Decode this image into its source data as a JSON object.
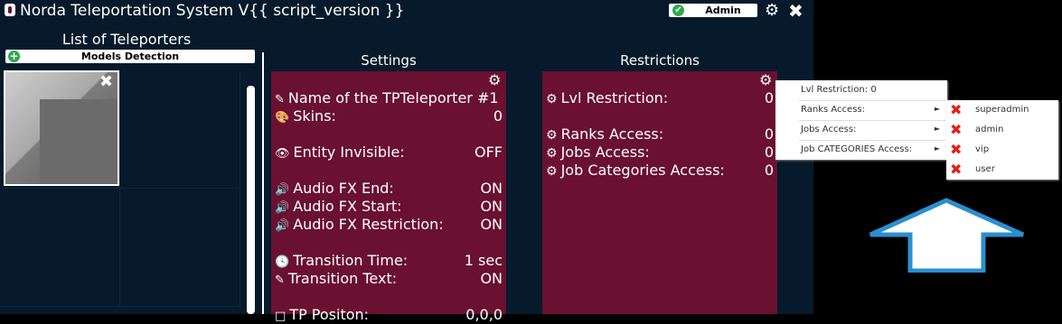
{
  "window": {
    "title": "Norda Teleportation System V{{ script_version }}",
    "role_badge": "Admin",
    "icons": [
      "app-icon",
      "check-icon",
      "gear-icon",
      "close-icon"
    ]
  },
  "left_panel": {
    "title": "List of Teleporters",
    "models_button": "Models Detection",
    "teleporter_thumb_icons": [
      "close-icon"
    ]
  },
  "settings": {
    "title": "Settings",
    "rows": [
      {
        "icon": "pencil-icon",
        "glyph": "✎",
        "label": "Name of the TPTeleporter #1",
        "value": ""
      },
      {
        "icon": "palette-icon",
        "glyph": "🎨",
        "label": "Skins:",
        "value": "0"
      },
      {
        "icon": "eye-icon",
        "glyph": "👁",
        "label": "Entity Invisible:",
        "value": "OFF"
      },
      {
        "icon": "speaker-icon",
        "glyph": "🔊",
        "label": "Audio FX End:",
        "value": "ON"
      },
      {
        "icon": "speaker-icon",
        "glyph": "🔊",
        "label": "Audio FX Start:",
        "value": "ON"
      },
      {
        "icon": "speaker-icon",
        "glyph": "🔊",
        "label": "Audio FX Restriction:",
        "value": "ON"
      },
      {
        "icon": "clock-icon",
        "glyph": "🕓",
        "label": "Transition Time:",
        "value": "1 sec"
      },
      {
        "icon": "pencil-icon",
        "glyph": "✎",
        "label": "Transition Text:",
        "value": "ON"
      },
      {
        "icon": "square-icon",
        "glyph": "□",
        "label": "TP Positon:",
        "value": "0,0,0"
      }
    ]
  },
  "restrictions": {
    "title": "Restrictions",
    "rows": [
      {
        "icon": "gear-icon",
        "glyph": "⚙",
        "label": "Lvl Restriction:",
        "value": "0"
      },
      {
        "icon": "gear-icon",
        "glyph": "⚙",
        "label": "Ranks Access:",
        "value": "0"
      },
      {
        "icon": "gear-icon",
        "glyph": "⚙",
        "label": "Jobs Access:",
        "value": "0"
      },
      {
        "icon": "gear-icon",
        "glyph": "⚙",
        "label": "Job Categories Access:",
        "value": "0"
      }
    ]
  },
  "context_menu": {
    "items": [
      {
        "label": "Lvl Restriction: 0",
        "has_submenu": false
      },
      {
        "label": "Ranks Access:",
        "has_submenu": true
      },
      {
        "label": "Jobs Access:",
        "has_submenu": true
      },
      {
        "label": "Job CATEGORIES Access:",
        "has_submenu": true
      }
    ],
    "submenu_arrow": "►"
  },
  "ranks_submenu": {
    "icon": "x-icon",
    "glyph": "✖",
    "items": [
      "superadmin",
      "admin",
      "vip",
      "user"
    ]
  },
  "colors": {
    "window_bg": "#061a2b",
    "panel_bg": "#6a1030",
    "accent_green": "#2fa84f",
    "remove_red": "#e0201a",
    "arrow_outline": "#2a8fd0"
  }
}
